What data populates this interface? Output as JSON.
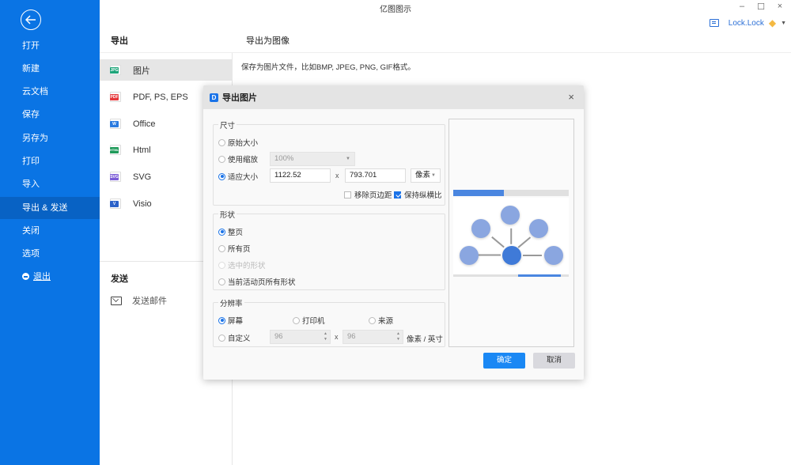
{
  "app": {
    "title": "亿图图示"
  },
  "window_controls": {
    "minimize": "–",
    "maximize": "☐",
    "close": "×"
  },
  "user": {
    "name": "Lock.Lock",
    "badge_icon": "diamond-vip-icon",
    "message_icon": "message-icon"
  },
  "sidebar": {
    "back_icon": "arrow-left-circle-icon",
    "items": [
      {
        "label": "打开"
      },
      {
        "label": "新建"
      },
      {
        "label": "云文档"
      },
      {
        "label": "保存"
      },
      {
        "label": "另存为"
      },
      {
        "label": "打印"
      },
      {
        "label": "导入"
      },
      {
        "label": "导出 & 发送",
        "active": true
      },
      {
        "label": "关闭"
      },
      {
        "label": "选项"
      },
      {
        "label": "退出",
        "icon": "minus-circle-icon"
      }
    ],
    "colors": {
      "background": "#0a74e4",
      "active": "#0862c4"
    }
  },
  "export_panel": {
    "header": "导出",
    "formats": [
      {
        "label": "图片",
        "icon_tag": "JPG",
        "color": "#1fa57a",
        "active": true
      },
      {
        "label": "PDF, PS, EPS",
        "icon_tag": "PDF",
        "color": "#e5383b"
      },
      {
        "label": "Office",
        "icon_tag": "W",
        "color": "#2b7be0"
      },
      {
        "label": "Html",
        "icon_tag": "HTML",
        "color": "#1f9a5a"
      },
      {
        "label": "SVG",
        "icon_tag": "SVG",
        "color": "#7b5cd6"
      },
      {
        "label": "Visio",
        "icon_tag": "V",
        "color": "#2b62c9"
      }
    ],
    "send_header": "发送",
    "send_items": [
      {
        "label": "发送邮件",
        "icon": "mail-send-icon"
      }
    ]
  },
  "content": {
    "header": "导出为图像",
    "description": "保存为图片文件，比如BMP, JPEG, PNG, GIF格式。"
  },
  "dialog": {
    "title": "导出图片",
    "close": "×",
    "size_group": {
      "title": "尺寸",
      "options": [
        {
          "label": "原始大小",
          "selected": false
        },
        {
          "label": "使用缩放",
          "selected": false
        },
        {
          "label": "适应大小",
          "selected": true
        }
      ],
      "zoom_value": "100%",
      "width": "1122.52",
      "height": "793.701",
      "times": "x",
      "unit": "像素",
      "remove_margin": {
        "label": "移除页边距",
        "checked": false
      },
      "keep_ratio": {
        "label": "保持纵横比",
        "checked": true
      }
    },
    "shape_group": {
      "title": "形状",
      "options": [
        {
          "label": "整页",
          "selected": true,
          "disabled": false
        },
        {
          "label": "所有页",
          "selected": false,
          "disabled": false
        },
        {
          "label": "选中的形状",
          "selected": false,
          "disabled": true
        },
        {
          "label": "当前活动页所有形状",
          "selected": false,
          "disabled": false
        }
      ]
    },
    "resolution_group": {
      "title": "分辨率",
      "options": [
        {
          "label": "屏幕",
          "selected": true
        },
        {
          "label": "打印机",
          "selected": false
        },
        {
          "label": "来源",
          "selected": false
        },
        {
          "label": "自定义",
          "selected": false
        }
      ],
      "dpi_x": "96",
      "dpi_y": "96",
      "times": "x",
      "unit": "像素 / 英寸"
    },
    "ok": "确定",
    "cancel": "取消",
    "colors": {
      "accent": "#1a88f4",
      "cancel_bg": "#d9d9de"
    }
  }
}
